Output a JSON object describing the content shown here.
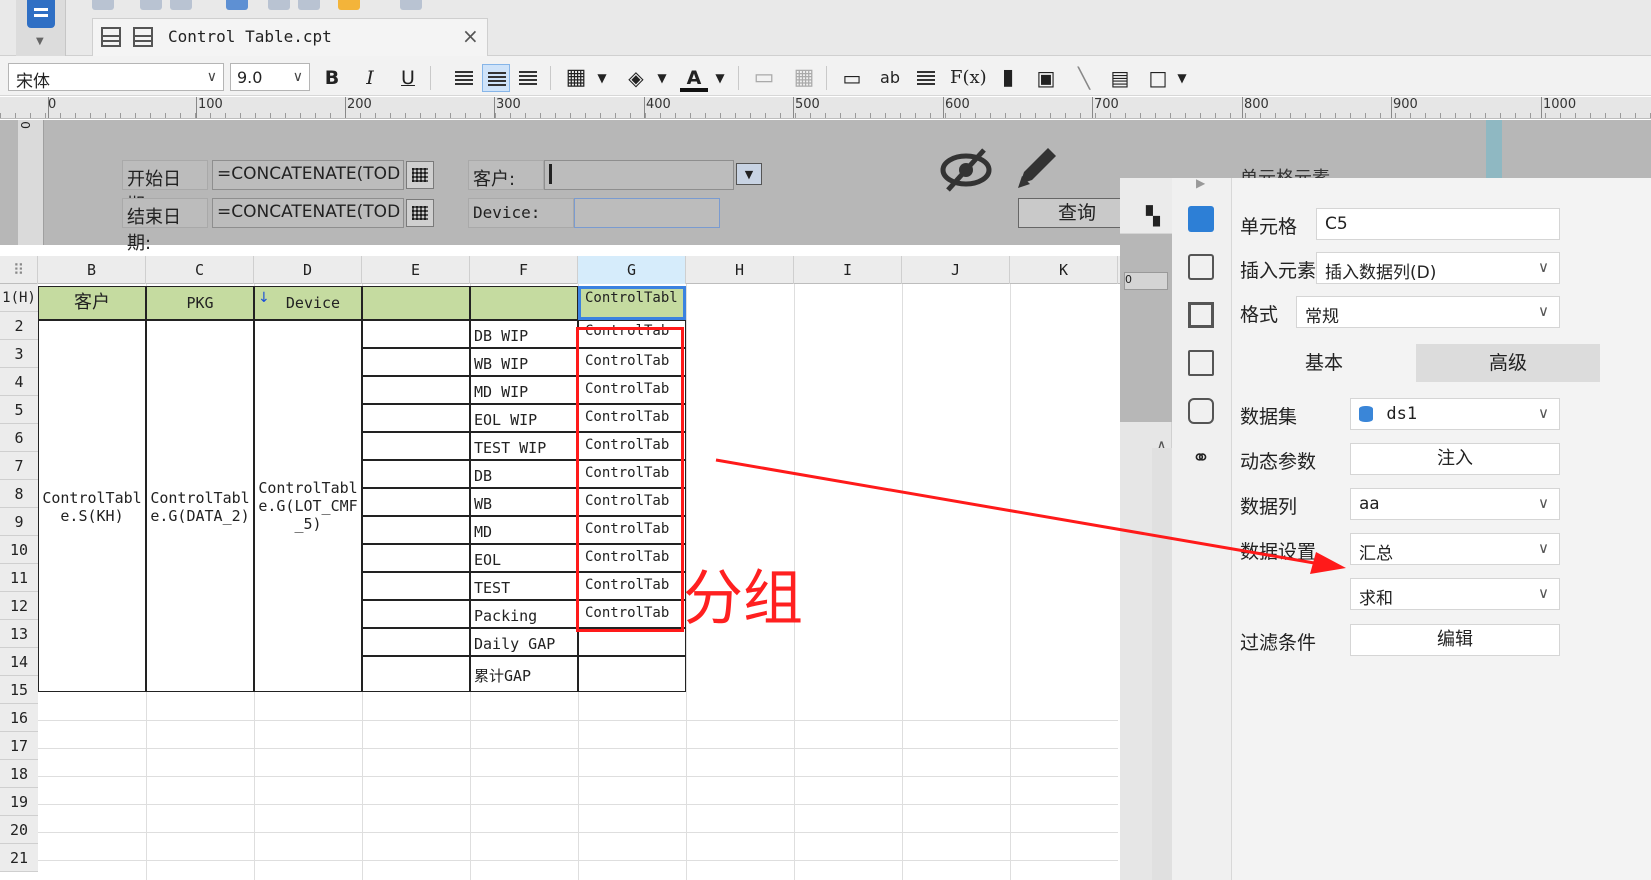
{
  "window": {
    "tab_title": "Control Table.cpt",
    "tab_close": "×"
  },
  "toolbar": {
    "font": "宋体",
    "size": "9.0",
    "bold": "B",
    "italic": "I",
    "underline": "U",
    "formula_label": "F(x)",
    "ab_label": "ab"
  },
  "ruler": {
    "ticks": [
      "0",
      "100",
      "200",
      "300",
      "400",
      "500",
      "600",
      "700",
      "800",
      "900",
      "1000"
    ],
    "zero": "0"
  },
  "params": {
    "start_label": "开始日期:",
    "start_value": "=CONCATENATE(TOD",
    "end_label": "结束日期:",
    "end_value": "=CONCATENATE(TOD",
    "customer_label": "客户:",
    "device_label": "Device:",
    "query": "查询"
  },
  "sheet": {
    "columns": [
      "B",
      "C",
      "D",
      "E",
      "F",
      "G",
      "H",
      "I",
      "J",
      "K"
    ],
    "selected_column": "G",
    "rows": [
      "1(H)",
      "2",
      "3",
      "4",
      "5",
      "6",
      "7",
      "8",
      "9",
      "10",
      "11",
      "12",
      "13",
      "14",
      "15",
      "16",
      "17",
      "18",
      "19",
      "20",
      "21"
    ],
    "header": {
      "b": "客户",
      "c": "PKG",
      "d": "Device",
      "g": "ControlTabl"
    },
    "merged": {
      "b": "ControlTable.S(KH)",
      "c": "ControlTable.G(DATA_2)",
      "d": "ControlTable.G(LOT_CMF_5)"
    },
    "f_items": [
      "DB WIP",
      "WB WIP",
      "MD WIP",
      "EOL WIP",
      "TEST WIP",
      "DB",
      "WB",
      "MD",
      "EOL",
      "TEST",
      "Packing",
      "Daily GAP",
      "累计GAP"
    ],
    "g_cell": "ControlTab"
  },
  "panel": {
    "title": "单元格元素",
    "cell_label": "单元格",
    "cell_value": "C5",
    "insert_label": "插入元素",
    "insert_value": "插入数据列(D)",
    "format_label": "格式",
    "format_value": "常规",
    "tab_basic": "基本",
    "tab_advanced": "高级",
    "dataset_label": "数据集",
    "dataset_value": "ds1",
    "dynamic_label": "动态参数",
    "inject": "注入",
    "column_label": "数据列",
    "column_value": "aa",
    "setting_label": "数据设置",
    "setting_value": "汇总",
    "agg_value": "求和",
    "filter_label": "过滤条件",
    "edit": "编辑"
  },
  "annotation": {
    "text": "分组",
    "color": "#ff2020"
  }
}
